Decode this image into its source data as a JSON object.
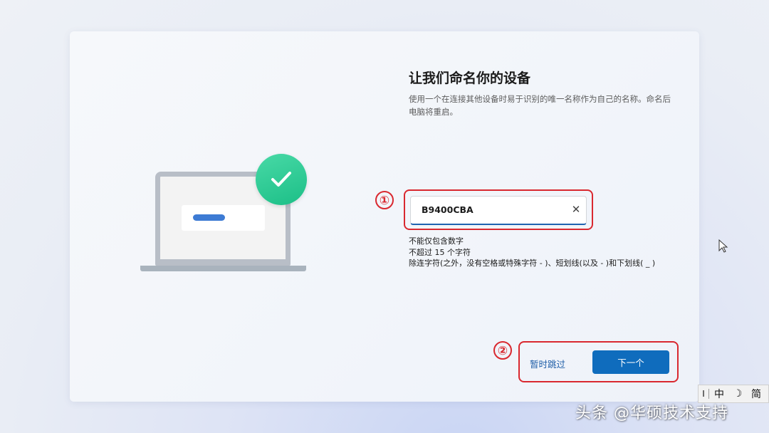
{
  "dialog": {
    "title": "让我们命名你的设备",
    "description": "使用一个在连接其他设备时易于识别的唯一名称作为自己的名称。命名后电脑将重启。"
  },
  "name_field": {
    "value": "B9400CBA",
    "clear_icon": "close-icon"
  },
  "rules": [
    "不能仅包含数字",
    "不超过 15 个字符",
    "除连字符(之外，没有空格或特殊字符 - )、短划线(以及 - )和下划线( _ )"
  ],
  "buttons": {
    "skip": "暂时跳过",
    "next": "下一个"
  },
  "annotations": {
    "marker_1": "①",
    "marker_2": "②",
    "color": "#d9282f"
  },
  "ime_bar": {
    "cursor": "I",
    "mode": "中",
    "moon": "☽",
    "script": "简"
  },
  "watermark": "头条 @华硕技术支持",
  "colors": {
    "accent": "#0f6cbd",
    "check": "#1cbf87"
  }
}
